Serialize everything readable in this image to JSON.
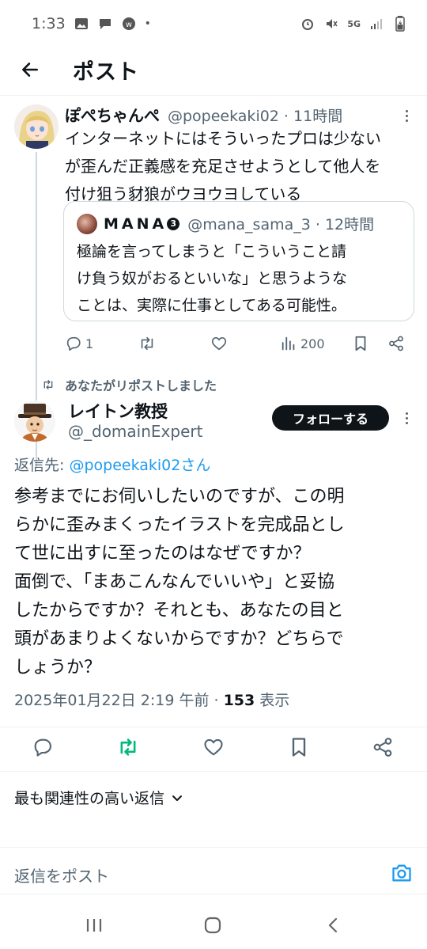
{
  "status_bar": {
    "time": "1:33",
    "network": "5G"
  },
  "header": {
    "title": "ポスト"
  },
  "parent_post": {
    "author_name": "ぽぺちゃんぺ",
    "handle_time": "@popeekaki02 · 11時間",
    "text_lines": [
      "インターネットにはそういったプロは少ない",
      "が歪んだ正義感を充足させようとして他人を",
      "付け狙う豺狼がウヨウヨしている"
    ],
    "quote": {
      "author_name": "MANA",
      "badge": "3",
      "handle_time": "@mana_sama_3 · 12時間",
      "text_lines": [
        "極論を言ってしまうと「こういうこと請",
        "け負う奴がおるといいな」と思うような",
        "ことは、実際に仕事としてある可能性。"
      ]
    },
    "actions": {
      "replies": "1",
      "views": "200"
    }
  },
  "repost_label": "あなたがリポストしました",
  "main_post": {
    "author_name": "レイトン教授",
    "handle": "@_domainExpert",
    "follow_label": "フォローする",
    "reply_prefix": "返信先: ",
    "reply_mention": "@popeekaki02さん",
    "text_lines": [
      "参考までにお伺いしたいのですが、この明",
      "らかに歪みまくったイラストを完成品とし",
      "て世に出すに至ったのはなぜですか？",
      "面倒で、「まあこんなんでいいや」と妥協",
      "したからですか？それとも、あなたの目と",
      "頭があまりよくないからですか？どちらで",
      "しょうか？"
    ],
    "timestamp": "2025年01月22日 2:19 午前 · ",
    "view_count": "153",
    "view_label": " 表示"
  },
  "sort_label": "最も関連性の高い返信",
  "reply_placeholder": "返信をポスト",
  "colors": {
    "accent": "#1d9bf0",
    "retweet_green": "#00ba7c",
    "text": "#0f1419",
    "muted": "#536471"
  }
}
